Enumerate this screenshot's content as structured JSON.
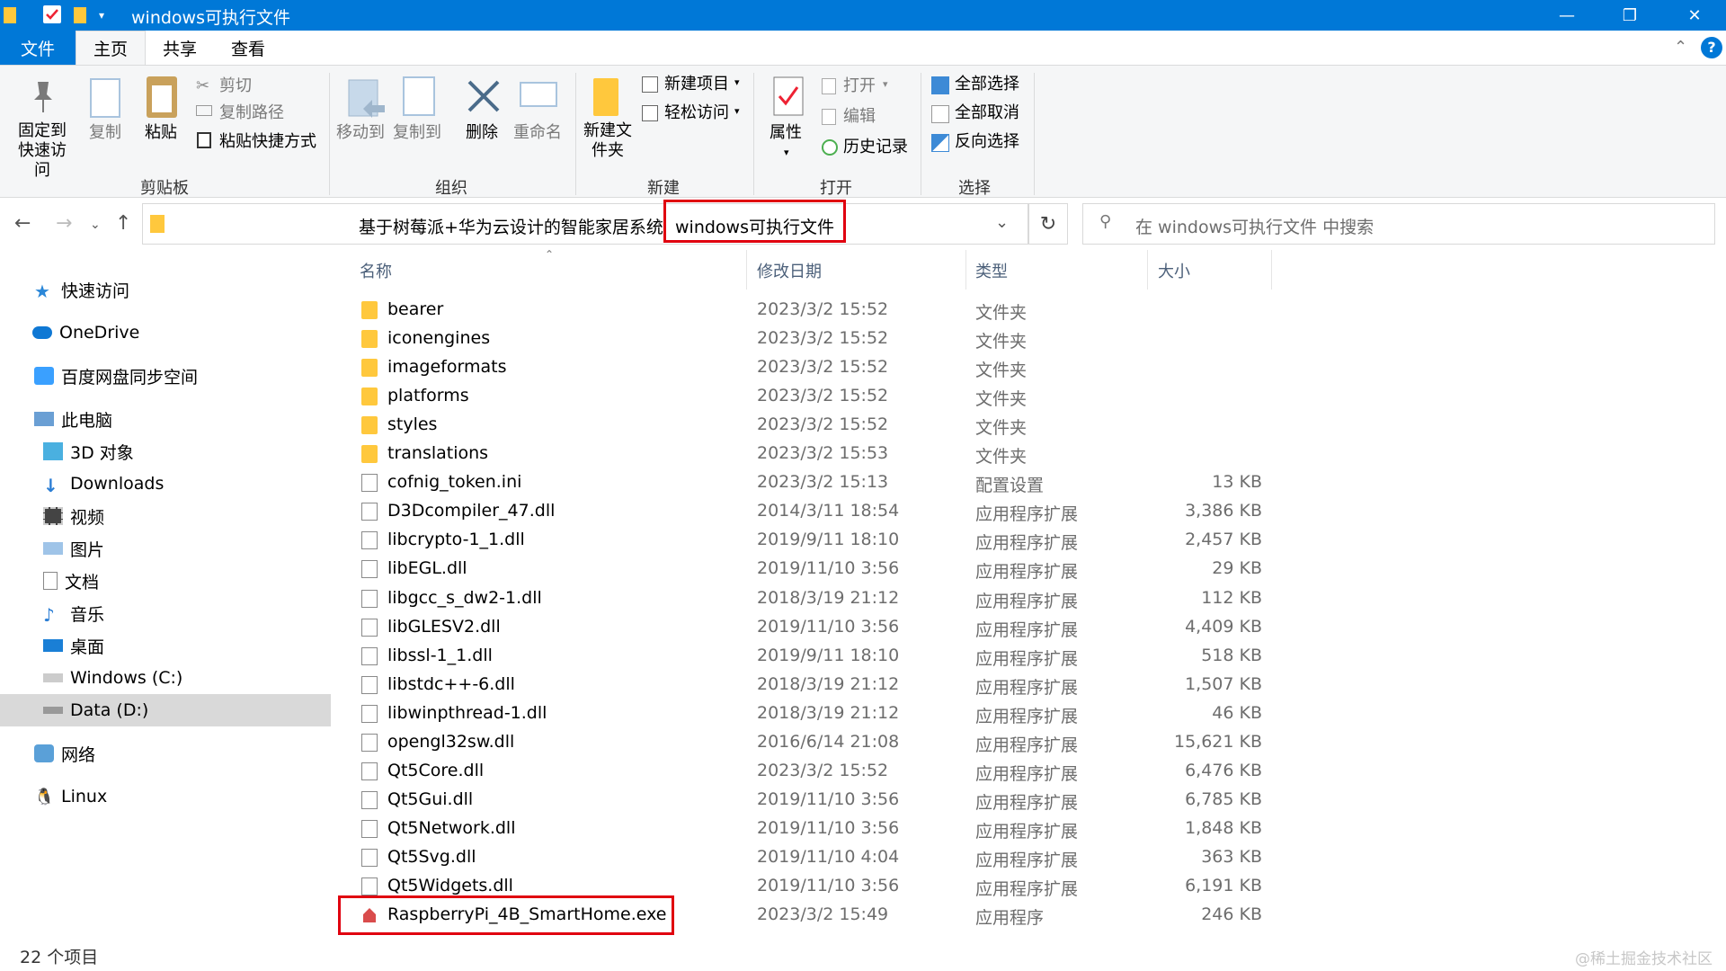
{
  "window": {
    "title": "windows可执行文件",
    "controls": {
      "minimize": "—",
      "maximize": "❐",
      "close": "✕"
    }
  },
  "ribbon_tabs": [
    "文件",
    "主页",
    "共享",
    "查看"
  ],
  "ribbon": {
    "pin_label": "固定到快速访问",
    "copy_label": "复制",
    "paste_label": "粘贴",
    "cut_label": "剪切",
    "copy_path_label": "复制路径",
    "paste_shortcut_label": "粘贴快捷方式",
    "clipboard_group": "剪贴板",
    "move_to_label": "移动到",
    "copy_to_label": "复制到",
    "delete_label": "删除",
    "rename_label": "重命名",
    "organize_group": "组织",
    "new_folder_label": "新建文件夹",
    "new_item_label": "新建项目",
    "easy_access_label": "轻松访问",
    "new_group": "新建",
    "properties_label": "属性",
    "open_label": "打开",
    "edit_label": "编辑",
    "history_label": "历史记录",
    "open_group": "打开",
    "select_all_label": "全部选择",
    "select_none_label": "全部取消",
    "invert_selection_label": "反向选择",
    "select_group": "选择"
  },
  "address": {
    "parent_folder": "基于树莓派+华为云设计的智能家居系统",
    "current_folder": "windows可执行文件",
    "search_placeholder": "在 windows可执行文件 中搜索"
  },
  "nav": {
    "quick_access": "快速访问",
    "onedrive": "OneDrive",
    "baidu": "百度网盘同步空间",
    "this_pc": "此电脑",
    "objects3d": "3D 对象",
    "downloads": "Downloads",
    "videos": "视频",
    "pictures": "图片",
    "documents": "文档",
    "music": "音乐",
    "desktop": "桌面",
    "drive_c": "Windows (C:)",
    "drive_d": "Data (D:)",
    "network": "网络",
    "linux": "Linux"
  },
  "columns": {
    "name": "名称",
    "date": "修改日期",
    "type": "类型",
    "size": "大小"
  },
  "files": [
    {
      "name": "bearer",
      "date": "2023/3/2 15:52",
      "type": "文件夹",
      "size": "",
      "kind": "folder"
    },
    {
      "name": "iconengines",
      "date": "2023/3/2 15:52",
      "type": "文件夹",
      "size": "",
      "kind": "folder"
    },
    {
      "name": "imageformats",
      "date": "2023/3/2 15:52",
      "type": "文件夹",
      "size": "",
      "kind": "folder"
    },
    {
      "name": "platforms",
      "date": "2023/3/2 15:52",
      "type": "文件夹",
      "size": "",
      "kind": "folder"
    },
    {
      "name": "styles",
      "date": "2023/3/2 15:52",
      "type": "文件夹",
      "size": "",
      "kind": "folder"
    },
    {
      "name": "translations",
      "date": "2023/3/2 15:53",
      "type": "文件夹",
      "size": "",
      "kind": "folder"
    },
    {
      "name": "cofnig_token.ini",
      "date": "2023/3/2 15:13",
      "type": "配置设置",
      "size": "13 KB",
      "kind": "doc"
    },
    {
      "name": "D3Dcompiler_47.dll",
      "date": "2014/3/11 18:54",
      "type": "应用程序扩展",
      "size": "3,386 KB",
      "kind": "doc"
    },
    {
      "name": "libcrypto-1_1.dll",
      "date": "2019/9/11 18:10",
      "type": "应用程序扩展",
      "size": "2,457 KB",
      "kind": "doc"
    },
    {
      "name": "libEGL.dll",
      "date": "2019/11/10 3:56",
      "type": "应用程序扩展",
      "size": "29 KB",
      "kind": "doc"
    },
    {
      "name": "libgcc_s_dw2-1.dll",
      "date": "2018/3/19 21:12",
      "type": "应用程序扩展",
      "size": "112 KB",
      "kind": "doc"
    },
    {
      "name": "libGLESV2.dll",
      "date": "2019/11/10 3:56",
      "type": "应用程序扩展",
      "size": "4,409 KB",
      "kind": "doc"
    },
    {
      "name": "libssl-1_1.dll",
      "date": "2019/9/11 18:10",
      "type": "应用程序扩展",
      "size": "518 KB",
      "kind": "doc"
    },
    {
      "name": "libstdc++-6.dll",
      "date": "2018/3/19 21:12",
      "type": "应用程序扩展",
      "size": "1,507 KB",
      "kind": "doc"
    },
    {
      "name": "libwinpthread-1.dll",
      "date": "2018/3/19 21:12",
      "type": "应用程序扩展",
      "size": "46 KB",
      "kind": "doc"
    },
    {
      "name": "opengl32sw.dll",
      "date": "2016/6/14 21:08",
      "type": "应用程序扩展",
      "size": "15,621 KB",
      "kind": "doc"
    },
    {
      "name": "Qt5Core.dll",
      "date": "2023/3/2 15:52",
      "type": "应用程序扩展",
      "size": "6,476 KB",
      "kind": "doc"
    },
    {
      "name": "Qt5Gui.dll",
      "date": "2019/11/10 3:56",
      "type": "应用程序扩展",
      "size": "6,785 KB",
      "kind": "doc"
    },
    {
      "name": "Qt5Network.dll",
      "date": "2019/11/10 3:56",
      "type": "应用程序扩展",
      "size": "1,848 KB",
      "kind": "doc"
    },
    {
      "name": "Qt5Svg.dll",
      "date": "2019/11/10 4:04",
      "type": "应用程序扩展",
      "size": "363 KB",
      "kind": "doc"
    },
    {
      "name": "Qt5Widgets.dll",
      "date": "2019/11/10 3:56",
      "type": "应用程序扩展",
      "size": "6,191 KB",
      "kind": "doc"
    },
    {
      "name": "RaspberryPi_4B_SmartHome.exe",
      "date": "2023/3/2 15:49",
      "type": "应用程序",
      "size": "246 KB",
      "kind": "exe"
    }
  ],
  "status": {
    "item_count": "22 个项目"
  },
  "watermark": "@稀土掘金技术社区",
  "colors": {
    "accent": "#0078d7",
    "highlight": "#e0000f",
    "folder": "#ffc83d"
  }
}
